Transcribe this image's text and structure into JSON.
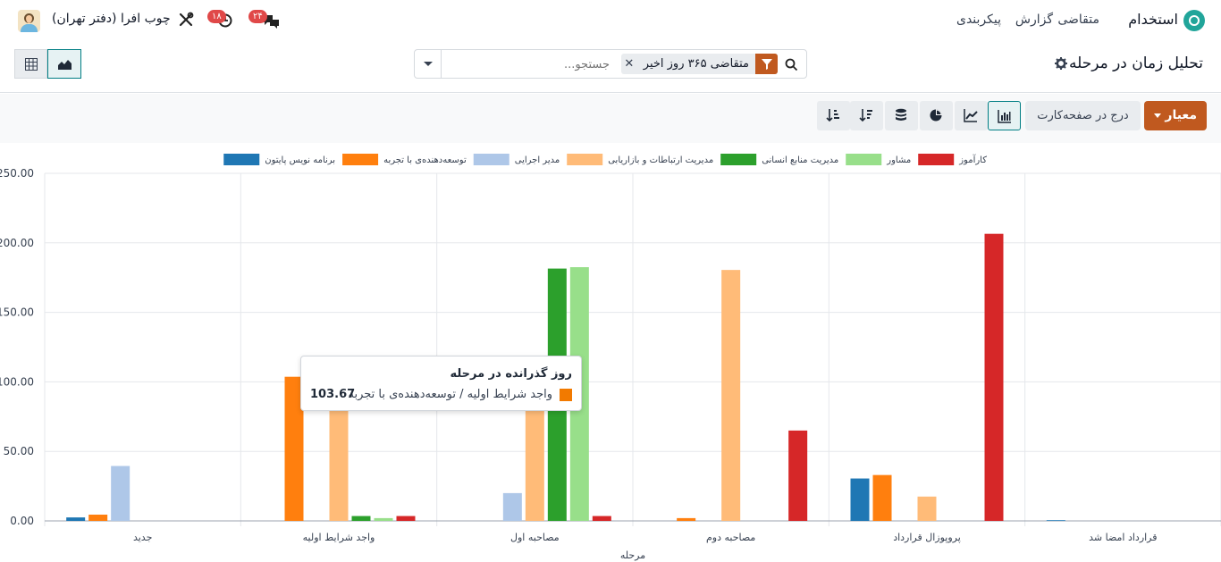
{
  "navbar": {
    "app_title": "استخدام",
    "menu": [
      "متقاضی",
      "گزارش",
      "پیکربندی"
    ],
    "company": "چوب افرا (دفتر تهران)",
    "activity_badge": "۱۸",
    "message_badge": "۲۴"
  },
  "control": {
    "page_title": "تحلیل زمان در مرحله",
    "search_placeholder": "جستجو...",
    "facet": "متقاضی ۳۶۵ روز اخیر"
  },
  "toolbar": {
    "measure_label": "معیار",
    "insert_label": "درج در صفحه‌کارت"
  },
  "colors": {
    "accent": "#c0591f",
    "teal": "#017e84"
  },
  "chart_data": {
    "type": "bar",
    "xlabel": "مرحله",
    "ylabel": "",
    "ylim": [
      0,
      250
    ],
    "yticks": [
      "0.00",
      "50.00",
      "100.00",
      "150.00",
      "200.00",
      "250.00"
    ],
    "legend_position": "top",
    "categories": [
      "جدید",
      "واجد شرایط اولیه",
      "مصاحبه اول",
      "مصاحبه دوم",
      "پروپوزال قرارداد",
      "قرارداد امضا شد"
    ],
    "series": [
      {
        "name": "برنامه نویس پایتون",
        "color": "#1f77b4",
        "values": [
          2.5,
          0,
          0,
          0,
          30.5,
          0.5
        ]
      },
      {
        "name": "توسعه‌دهنده‌ی با تجربه",
        "color": "#ff7f0e",
        "values": [
          4.5,
          103.67,
          0,
          2,
          33,
          0
        ]
      },
      {
        "name": "مدیر اجرایی",
        "color": "#aec7e8",
        "values": [
          39.5,
          0,
          20,
          0,
          0,
          0
        ]
      },
      {
        "name": "مدیریت ارتباطات و بازاریابی",
        "color": "#ffbb78",
        "values": [
          0,
          84,
          84,
          180.5,
          17.5,
          0
        ]
      },
      {
        "name": "مدیریت منابع انسانی",
        "color": "#2ca02c",
        "values": [
          0,
          3.5,
          181.5,
          0,
          0,
          0
        ]
      },
      {
        "name": "مشاور",
        "color": "#98df8a",
        "values": [
          0,
          2,
          182.5,
          0,
          0,
          0
        ]
      },
      {
        "name": "کارآموز",
        "color": "#d62728",
        "values": [
          0,
          3.5,
          3.5,
          65,
          206.5,
          0
        ]
      }
    ],
    "tooltip": {
      "title": "روز گذرانده در مرحله",
      "label": "واجد شرایط اولیه / توسعه‌دهنده‌ی با تجربه",
      "value": "103.67"
    }
  }
}
